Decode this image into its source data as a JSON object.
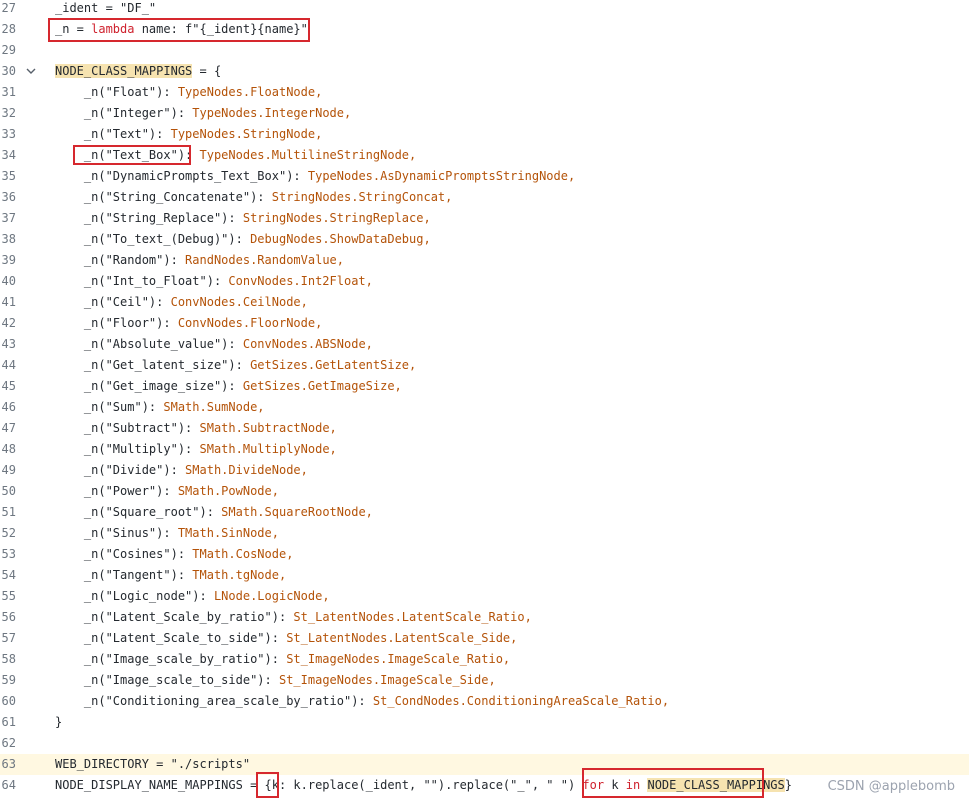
{
  "editor": {
    "lines": [
      {
        "num": "27",
        "parts": [
          {
            "t": "_ident = \"DF_\"",
            "c": "n"
          }
        ]
      },
      {
        "num": "28",
        "parts": [
          {
            "t": "_n = ",
            "c": "n"
          },
          {
            "t": "lambda",
            "c": "k"
          },
          {
            "t": " name: f\"{_ident}{name}\"",
            "c": "n"
          }
        ]
      },
      {
        "num": "29",
        "parts": []
      },
      {
        "num": "30",
        "fold": true,
        "parts": [
          {
            "t": "NODE_CLASS_MAPPINGS",
            "c": "n bg"
          },
          {
            "t": " = {",
            "c": "n"
          }
        ]
      },
      {
        "num": "31",
        "parts": [
          {
            "t": "    _n(\"Float\"): ",
            "c": "n"
          },
          {
            "t": "TypeNodes.FloatNode,",
            "c": "c"
          }
        ]
      },
      {
        "num": "32",
        "parts": [
          {
            "t": "    _n(\"Integer\"): ",
            "c": "n"
          },
          {
            "t": "TypeNodes.IntegerNode,",
            "c": "c"
          }
        ]
      },
      {
        "num": "33",
        "parts": [
          {
            "t": "    _n(\"Text\"): ",
            "c": "n"
          },
          {
            "t": "TypeNodes.StringNode,",
            "c": "c"
          }
        ]
      },
      {
        "num": "34",
        "parts": [
          {
            "t": "    _n(\"Text_Box\"): ",
            "c": "n"
          },
          {
            "t": "TypeNodes.MultilineStringNode,",
            "c": "c"
          }
        ]
      },
      {
        "num": "35",
        "parts": [
          {
            "t": "    _n(\"DynamicPrompts_Text_Box\"): ",
            "c": "n"
          },
          {
            "t": "TypeNodes.AsDynamicPromptsStringNode,",
            "c": "c"
          }
        ]
      },
      {
        "num": "36",
        "parts": [
          {
            "t": "    _n(\"String_Concatenate\"): ",
            "c": "n"
          },
          {
            "t": "StringNodes.StringConcat,",
            "c": "c"
          }
        ]
      },
      {
        "num": "37",
        "parts": [
          {
            "t": "    _n(\"String_Replace\"): ",
            "c": "n"
          },
          {
            "t": "StringNodes.StringReplace,",
            "c": "c"
          }
        ]
      },
      {
        "num": "38",
        "parts": [
          {
            "t": "    _n(\"To_text_(Debug)\"): ",
            "c": "n"
          },
          {
            "t": "DebugNodes.ShowDataDebug,",
            "c": "c"
          }
        ]
      },
      {
        "num": "39",
        "parts": [
          {
            "t": "    _n(\"Random\"): ",
            "c": "n"
          },
          {
            "t": "RandNodes.RandomValue,",
            "c": "c"
          }
        ]
      },
      {
        "num": "40",
        "parts": [
          {
            "t": "    _n(\"Int_to_Float\"): ",
            "c": "n"
          },
          {
            "t": "ConvNodes.Int2Float,",
            "c": "c"
          }
        ]
      },
      {
        "num": "41",
        "parts": [
          {
            "t": "    _n(\"Ceil\"): ",
            "c": "n"
          },
          {
            "t": "ConvNodes.CeilNode,",
            "c": "c"
          }
        ]
      },
      {
        "num": "42",
        "parts": [
          {
            "t": "    _n(\"Floor\"): ",
            "c": "n"
          },
          {
            "t": "ConvNodes.FloorNode,",
            "c": "c"
          }
        ]
      },
      {
        "num": "43",
        "parts": [
          {
            "t": "    _n(\"Absolute_value\"): ",
            "c": "n"
          },
          {
            "t": "ConvNodes.ABSNode,",
            "c": "c"
          }
        ]
      },
      {
        "num": "44",
        "parts": [
          {
            "t": "    _n(\"Get_latent_size\"): ",
            "c": "n"
          },
          {
            "t": "GetSizes.GetLatentSize,",
            "c": "c"
          }
        ]
      },
      {
        "num": "45",
        "parts": [
          {
            "t": "    _n(\"Get_image_size\"): ",
            "c": "n"
          },
          {
            "t": "GetSizes.GetImageSize,",
            "c": "c"
          }
        ]
      },
      {
        "num": "46",
        "parts": [
          {
            "t": "    _n(\"Sum\"): ",
            "c": "n"
          },
          {
            "t": "SMath.SumNode,",
            "c": "c"
          }
        ]
      },
      {
        "num": "47",
        "parts": [
          {
            "t": "    _n(\"Subtract\"): ",
            "c": "n"
          },
          {
            "t": "SMath.SubtractNode,",
            "c": "c"
          }
        ]
      },
      {
        "num": "48",
        "parts": [
          {
            "t": "    _n(\"Multiply\"): ",
            "c": "n"
          },
          {
            "t": "SMath.MultiplyNode,",
            "c": "c"
          }
        ]
      },
      {
        "num": "49",
        "parts": [
          {
            "t": "    _n(\"Divide\"): ",
            "c": "n"
          },
          {
            "t": "SMath.DivideNode,",
            "c": "c"
          }
        ]
      },
      {
        "num": "50",
        "parts": [
          {
            "t": "    _n(\"Power\"): ",
            "c": "n"
          },
          {
            "t": "SMath.PowNode,",
            "c": "c"
          }
        ]
      },
      {
        "num": "51",
        "parts": [
          {
            "t": "    _n(\"Square_root\"): ",
            "c": "n"
          },
          {
            "t": "SMath.SquareRootNode,",
            "c": "c"
          }
        ]
      },
      {
        "num": "52",
        "parts": [
          {
            "t": "    _n(\"Sinus\"): ",
            "c": "n"
          },
          {
            "t": "TMath.SinNode,",
            "c": "c"
          }
        ]
      },
      {
        "num": "53",
        "parts": [
          {
            "t": "    _n(\"Cosines\"): ",
            "c": "n"
          },
          {
            "t": "TMath.CosNode,",
            "c": "c"
          }
        ]
      },
      {
        "num": "54",
        "parts": [
          {
            "t": "    _n(\"Tangent\"): ",
            "c": "n"
          },
          {
            "t": "TMath.tgNode,",
            "c": "c"
          }
        ]
      },
      {
        "num": "55",
        "parts": [
          {
            "t": "    _n(\"Logic_node\"): ",
            "c": "n"
          },
          {
            "t": "LNode.LogicNode,",
            "c": "c"
          }
        ]
      },
      {
        "num": "56",
        "parts": [
          {
            "t": "    _n(\"Latent_Scale_by_ratio\"): ",
            "c": "n"
          },
          {
            "t": "St_LatentNodes.LatentScale_Ratio,",
            "c": "c"
          }
        ]
      },
      {
        "num": "57",
        "parts": [
          {
            "t": "    _n(\"Latent_Scale_to_side\"): ",
            "c": "n"
          },
          {
            "t": "St_LatentNodes.LatentScale_Side,",
            "c": "c"
          }
        ]
      },
      {
        "num": "58",
        "parts": [
          {
            "t": "    _n(\"Image_scale_by_ratio\"): ",
            "c": "n"
          },
          {
            "t": "St_ImageNodes.ImageScale_Ratio,",
            "c": "c"
          }
        ]
      },
      {
        "num": "59",
        "parts": [
          {
            "t": "    _n(\"Image_scale_to_side\"): ",
            "c": "n"
          },
          {
            "t": "St_ImageNodes.ImageScale_Side,",
            "c": "c"
          }
        ]
      },
      {
        "num": "60",
        "parts": [
          {
            "t": "    _n(\"Conditioning_area_scale_by_ratio\"): ",
            "c": "n"
          },
          {
            "t": "St_CondNodes.ConditioningAreaScale_Ratio,",
            "c": "c"
          }
        ]
      },
      {
        "num": "61",
        "parts": [
          {
            "t": "}",
            "c": "n"
          }
        ]
      },
      {
        "num": "62",
        "parts": []
      },
      {
        "num": "63",
        "highlight": true,
        "parts": [
          {
            "t": "WEB_DIRECTORY = \"./scripts\"",
            "c": "n"
          }
        ]
      },
      {
        "num": "64",
        "parts": [
          {
            "t": "NODE_DISPLAY_NAME_MAPPINGS = {k: k.replace(_ident, \"\").replace(\"_\", \" \") ",
            "c": "n"
          },
          {
            "t": "for",
            "c": "k"
          },
          {
            "t": " k ",
            "c": "n"
          },
          {
            "t": "in",
            "c": "k"
          },
          {
            "t": " ",
            "c": "n"
          },
          {
            "t": "NODE_CLASS_MAPPINGS",
            "c": "n bg"
          },
          {
            "t": "}",
            "c": "n"
          }
        ]
      }
    ]
  },
  "watermark": "CSDN @applebomb",
  "colors": {
    "annotation_box": "#d6282e",
    "class_ref": "#b45309",
    "keyword": "#cf222e",
    "mark_bg": "#f6e3b0"
  }
}
